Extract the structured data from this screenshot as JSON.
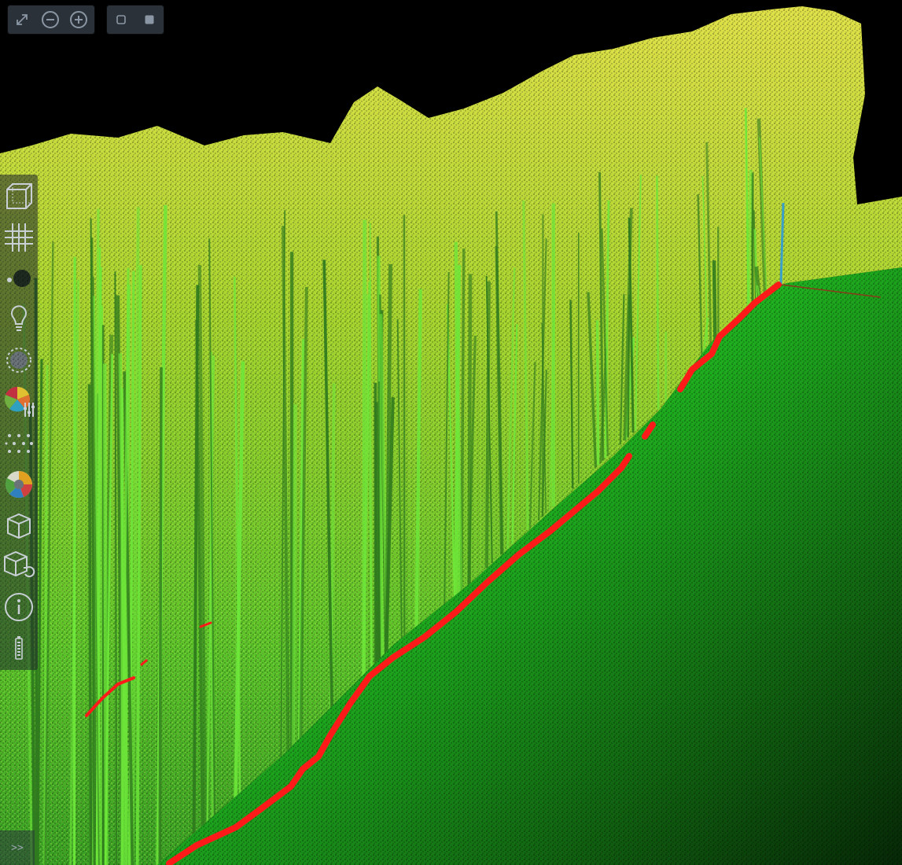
{
  "viewer": {
    "background_color": "#000000",
    "point_colors": {
      "canopy_top": "#e2e24a",
      "canopy_mid": "#9ed22e",
      "trunks": "#5ed82a",
      "ground": "#2ef02e",
      "ground_dark": "#0d4a0d"
    },
    "path_color": "#ff1a1a",
    "pole_color": "#3aa0c8"
  },
  "top_toolbar": {
    "zoom_group": [
      {
        "name": "fit-view-icon"
      },
      {
        "name": "zoom-out-icon"
      },
      {
        "name": "zoom-in-icon"
      }
    ],
    "mode_group": [
      {
        "name": "square-outline-icon"
      },
      {
        "name": "square-filled-icon"
      }
    ],
    "icon_color": "#8a96a3",
    "background_color": "#2b3138"
  },
  "sidebar": {
    "items": [
      {
        "name": "bounding-box-icon"
      },
      {
        "name": "grid-icon"
      },
      {
        "name": "point-size-icon"
      },
      {
        "name": "lighting-bulb-icon"
      },
      {
        "name": "point-budget-icon"
      },
      {
        "name": "color-adjust-icon"
      },
      {
        "name": "point-shape-icon"
      },
      {
        "name": "color-palette-icon"
      },
      {
        "name": "box-view-icon"
      },
      {
        "name": "reset-view-icon"
      },
      {
        "name": "info-icon"
      },
      {
        "name": "battery-level-icon"
      }
    ],
    "icon_color": "#c8d0d6",
    "expand_label": ">>"
  }
}
